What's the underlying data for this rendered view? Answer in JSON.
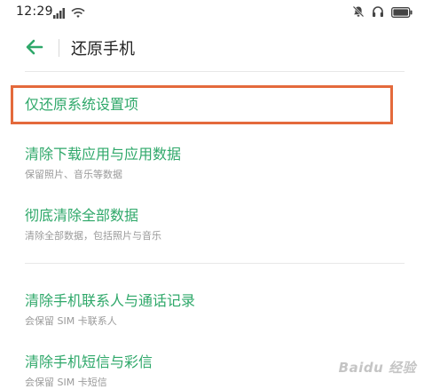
{
  "status_bar": {
    "time": "12:29"
  },
  "header": {
    "title": "还原手机"
  },
  "options": [
    {
      "title": "仅还原系统设置项",
      "subtitle": ""
    },
    {
      "title": "清除下载应用与应用数据",
      "subtitle": "保留照片、音乐等数据"
    },
    {
      "title": "彻底清除全部数据",
      "subtitle": "清除全部数据，包括照片与音乐"
    },
    {
      "title": "清除手机联系人与通话记录",
      "subtitle": "会保留 SIM 卡联系人"
    },
    {
      "title": "清除手机短信与彩信",
      "subtitle": "会保留 SIM 卡短信"
    }
  ],
  "watermark": "Baidu 经验",
  "colors": {
    "accent": "#2fa86a",
    "highlight": "#e46a3c"
  },
  "icons": {
    "back": "arrow-left-icon",
    "signal": "signal-icon",
    "wifi": "wifi-icon",
    "mute": "bell-off-icon",
    "headset": "headset-icon",
    "battery": "battery-icon"
  }
}
